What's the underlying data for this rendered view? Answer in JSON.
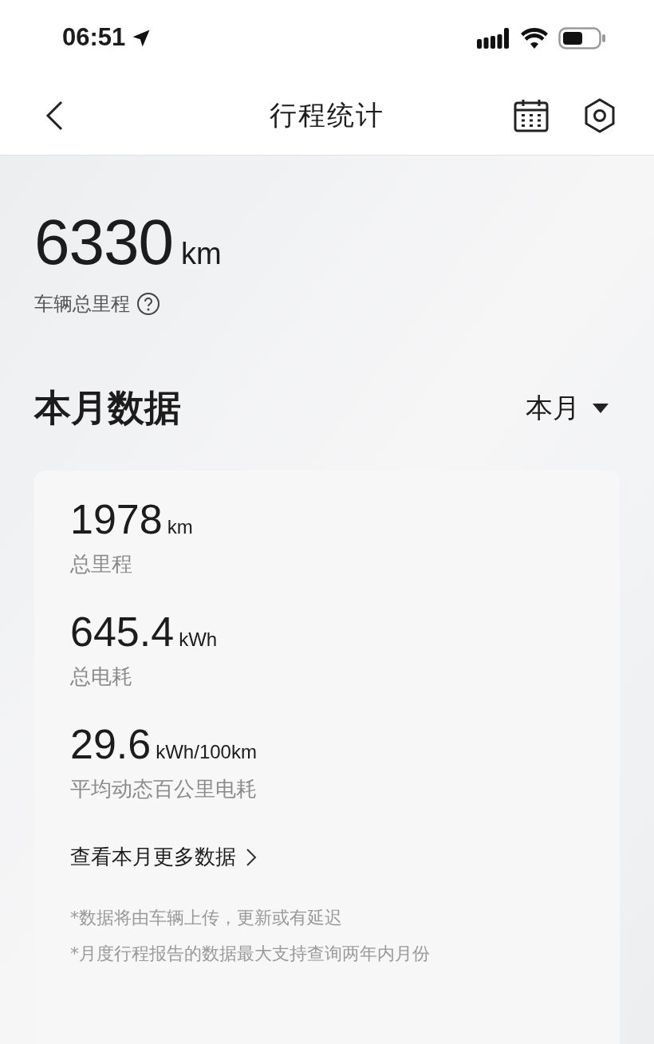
{
  "status_bar": {
    "time": "06:51"
  },
  "nav": {
    "title": "行程统计"
  },
  "total": {
    "value": "6330",
    "unit": "km",
    "label": "车辆总里程"
  },
  "section": {
    "title": "本月数据",
    "period": "本月"
  },
  "stats": [
    {
      "value": "1978",
      "unit": "km",
      "label": "总里程"
    },
    {
      "value": "645.4",
      "unit": "kWh",
      "label": "总电耗"
    },
    {
      "value": "29.6",
      "unit": "kWh/100km",
      "label": "平均动态百公里电耗"
    }
  ],
  "more_link": "查看本月更多数据",
  "notes": [
    "*数据将由车辆上传，更新或有延迟",
    "*月度行程报告的数据最大支持查询两年内月份"
  ]
}
